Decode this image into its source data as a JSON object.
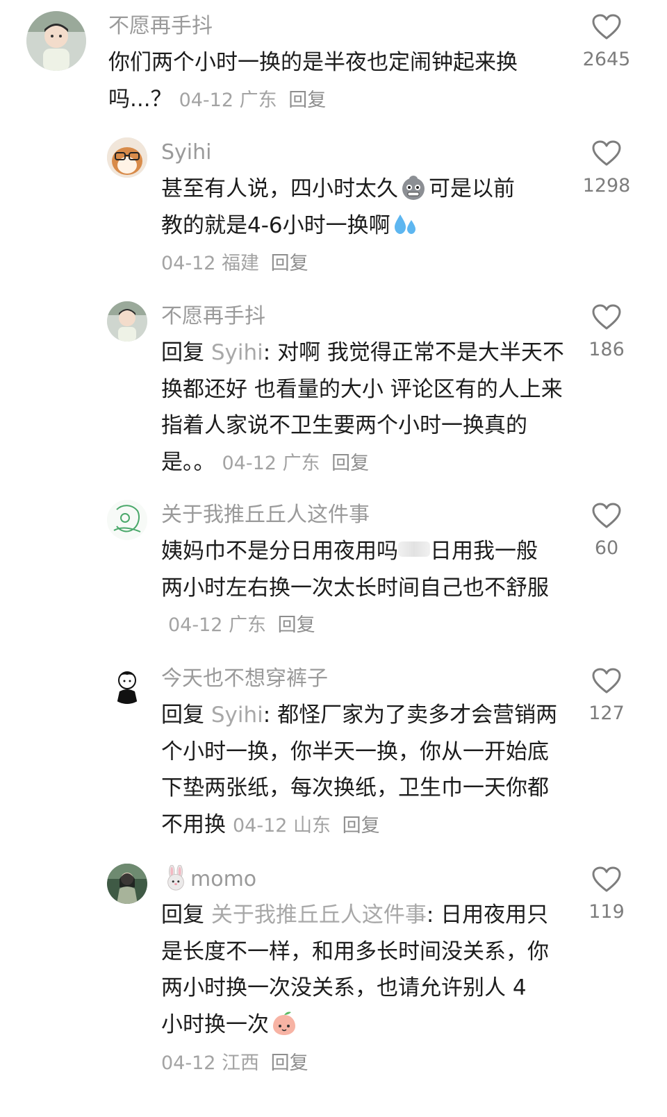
{
  "comments": [
    {
      "username": "不愿再手抖",
      "text": "你们两个小时一换的是半夜也定闹钟起来换吗...？",
      "date": "04-12",
      "location": "广东",
      "reply_label": "回复",
      "likes": "2645",
      "avatar_icon": "boy-avatar-icon"
    },
    {
      "username": "Syihi",
      "text_part1": "甚至有人说，四小时太久",
      "text_part2": "可是以前",
      "text_part3": "教的就是4-6小时一换啊",
      "date": "04-12",
      "location": "福建",
      "reply_label": "回复",
      "likes": "1298",
      "avatar_icon": "hamster-avatar-icon",
      "emojis": [
        "grimace-emoji",
        "sweat-drops-emoji"
      ]
    },
    {
      "username": "不愿再手抖",
      "reply_prefix": "回复 ",
      "reply_target": "Syihi",
      "text": ": 对啊  我觉得正常不是大半天不换都还好  也看量的大小    评论区有的人上来指着人家说不卫生要两个小时一换真的是。。",
      "date": "04-12",
      "location": "广东",
      "reply_label": "回复",
      "likes": "186",
      "avatar_icon": "boy-avatar-icon"
    },
    {
      "username": "关于我推丘丘人这件事",
      "text_part1": "姨妈巾不是分日用夜用吗",
      "text_part2": "日用我一般两小时左右换一次太长时间自己也不舒服",
      "date": "04-12",
      "location": "广东",
      "reply_label": "回复",
      "likes": "60",
      "avatar_icon": "green-sketch-avatar-icon"
    },
    {
      "username": "今天也不想穿裤子",
      "reply_prefix": "回复 ",
      "reply_target": "Syihi",
      "text": ": 都怪厂家为了卖多才会营销两个小时一换，你半天一换，你从一开始底下垫两张纸，每次换纸，卫生巾一天你都不用换",
      "date": "04-12",
      "location": "山东",
      "reply_label": "回复",
      "likes": "127",
      "avatar_icon": "cartoon-boy-avatar-icon"
    },
    {
      "username": "momo",
      "reply_prefix": "回复 ",
      "reply_target": "关于我推丘丘人这件事",
      "text": ": 日用夜用只是长度不一样，和用多长时间没关系，你两小时换一次没关系，也请允许别人 4 小时换一次",
      "date": "04-12",
      "location": "江西",
      "reply_label": "回复",
      "likes": "119",
      "avatar_icon": "girl-photo-avatar-icon",
      "emojis": [
        "rabbit-emoji",
        "peach-face-emoji"
      ]
    }
  ],
  "colors": {
    "username": "#9a9a9a",
    "text": "#1c1c1c",
    "meta": "#a3a3a3",
    "like_count": "#7d7d7d",
    "heart_stroke": "#7d7d7d"
  }
}
